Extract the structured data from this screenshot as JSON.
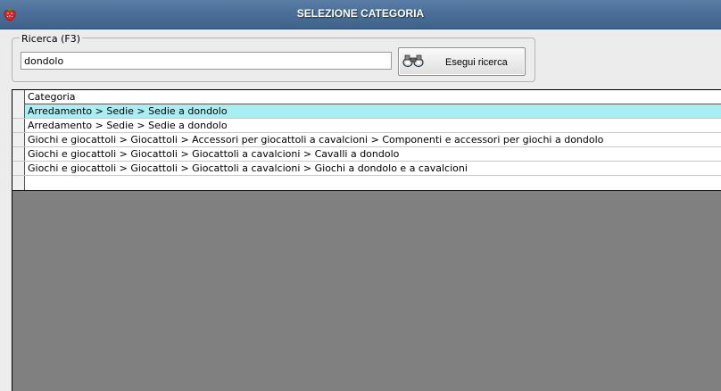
{
  "window": {
    "title": "SELEZIONE CATEGORIA",
    "icon": "strawberry-icon",
    "icon_color": "#d4262b"
  },
  "search": {
    "legend": "Ricerca (F3)",
    "value": "dondolo",
    "button_label": "Esegui ricerca",
    "button_icon": "binoculars-icon"
  },
  "grid": {
    "column_header": "Categoria",
    "selected_row_color": "#a9eef3",
    "rows": [
      {
        "text": "Arredamento > Sedie > Sedie a dondolo",
        "selected": true
      },
      {
        "text": "Arredamento > Sedie > Sedie a dondolo",
        "selected": false
      },
      {
        "text": "Giochi e giocattoli > Giocattoli > Accessori per giocattoli a cavalcioni > Componenti e accessori per giochi a dondolo",
        "selected": false
      },
      {
        "text": "Giochi e giocattoli > Giocattoli > Giocattoli a cavalcioni > Cavalli a dondolo",
        "selected": false
      },
      {
        "text": "Giochi e giocattoli > Giocattoli > Giocattoli a cavalcioni > Giochi a dondolo e a cavalcioni",
        "selected": false
      }
    ]
  }
}
